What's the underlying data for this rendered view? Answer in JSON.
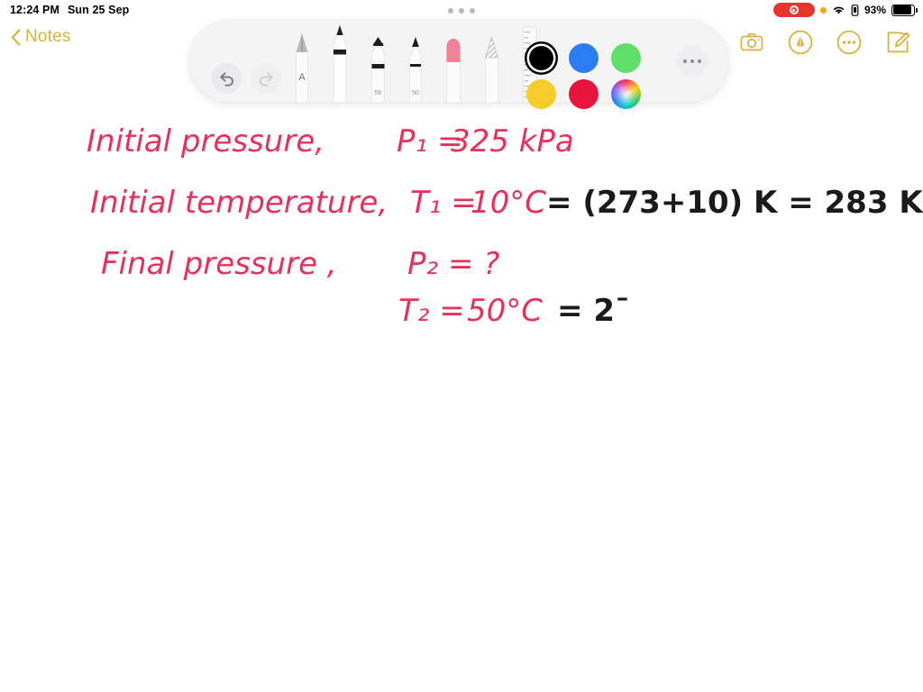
{
  "statusbar": {
    "time": "12:24 PM",
    "date": "Sun 25 Sep",
    "recording_icon": "screen-recording-pill",
    "privacy_icon": "orange-privacy-dot",
    "wifi_icon": "wifi-icon",
    "lock_icon": "battery-lock-icon",
    "battery_percent": "93%",
    "battery_icon": "battery-full-icon"
  },
  "navbar": {
    "back_label": "Notes",
    "back_icon": "chevron-left-icon",
    "actions": [
      {
        "name": "camera-icon",
        "label": "Camera"
      },
      {
        "name": "markup-icon",
        "label": "Markup"
      },
      {
        "name": "more-icon",
        "label": "More"
      },
      {
        "name": "compose-icon",
        "label": "Compose"
      }
    ]
  },
  "toolbar": {
    "drag_handle_icon": "drag-handle-dots",
    "undo": {
      "label": "Undo",
      "icon": "undo-arrow-icon",
      "enabled": true
    },
    "redo": {
      "label": "Redo",
      "icon": "redo-arrow-icon",
      "enabled": false
    },
    "tools": [
      {
        "name": "tool-fountain-pen",
        "label": "Fountain Pen",
        "badge": "A",
        "selected": false
      },
      {
        "name": "tool-pen",
        "label": "Pen",
        "badge": "",
        "selected": true
      },
      {
        "name": "tool-highlighter",
        "label": "Highlighter",
        "badge": "59",
        "selected": false
      },
      {
        "name": "tool-pencil",
        "label": "Pencil",
        "badge": "50",
        "selected": false
      },
      {
        "name": "tool-eraser",
        "label": "Eraser",
        "badge": "",
        "selected": false
      },
      {
        "name": "tool-lasso",
        "label": "Lasso Select",
        "badge": "",
        "selected": false
      },
      {
        "name": "tool-ruler",
        "label": "Ruler",
        "badge": "",
        "selected": false
      }
    ],
    "colors": [
      {
        "name": "swatch-black",
        "label": "Black",
        "hex": "#000000",
        "selected": true
      },
      {
        "name": "swatch-blue",
        "label": "Blue",
        "hex": "#2c7ef0",
        "selected": false
      },
      {
        "name": "swatch-green",
        "label": "Green",
        "hex": "#5ce06a",
        "selected": false
      },
      {
        "name": "swatch-yellow",
        "label": "Yellow",
        "hex": "#f5cc2a",
        "selected": false
      },
      {
        "name": "swatch-red",
        "label": "Red",
        "hex": "#e8143c",
        "selected": false
      },
      {
        "name": "swatch-color-picker",
        "label": "Color Picker",
        "hex": "rainbow",
        "selected": false
      }
    ],
    "more_label": "More Options"
  },
  "note": {
    "ink_red": "#e8305a",
    "ink_black": "#1a1a1a",
    "lines": [
      {
        "red": "Initial  pressure,",
        "red2": "P₁ =",
        "red3": "325 kPa",
        "black": ""
      },
      {
        "red": "Initial  temperature,",
        "red2": "T₁ =",
        "red3": "10°C",
        "black": "= (273+10) K = 283 K"
      },
      {
        "red": "Final  pressure ,",
        "red2": "P₂ = ?",
        "red3": "",
        "black": ""
      },
      {
        "red": "",
        "red2": "T₂ =",
        "red3": "50°C",
        "black": "= 2¯"
      }
    ],
    "text_plain": "Initial pressure, P1 = 325 kPa / Initial temperature, T1 = 10°C = (273+10)K = 283K / Final pressure, P2 = ? / T2 = 50°C = 2"
  }
}
